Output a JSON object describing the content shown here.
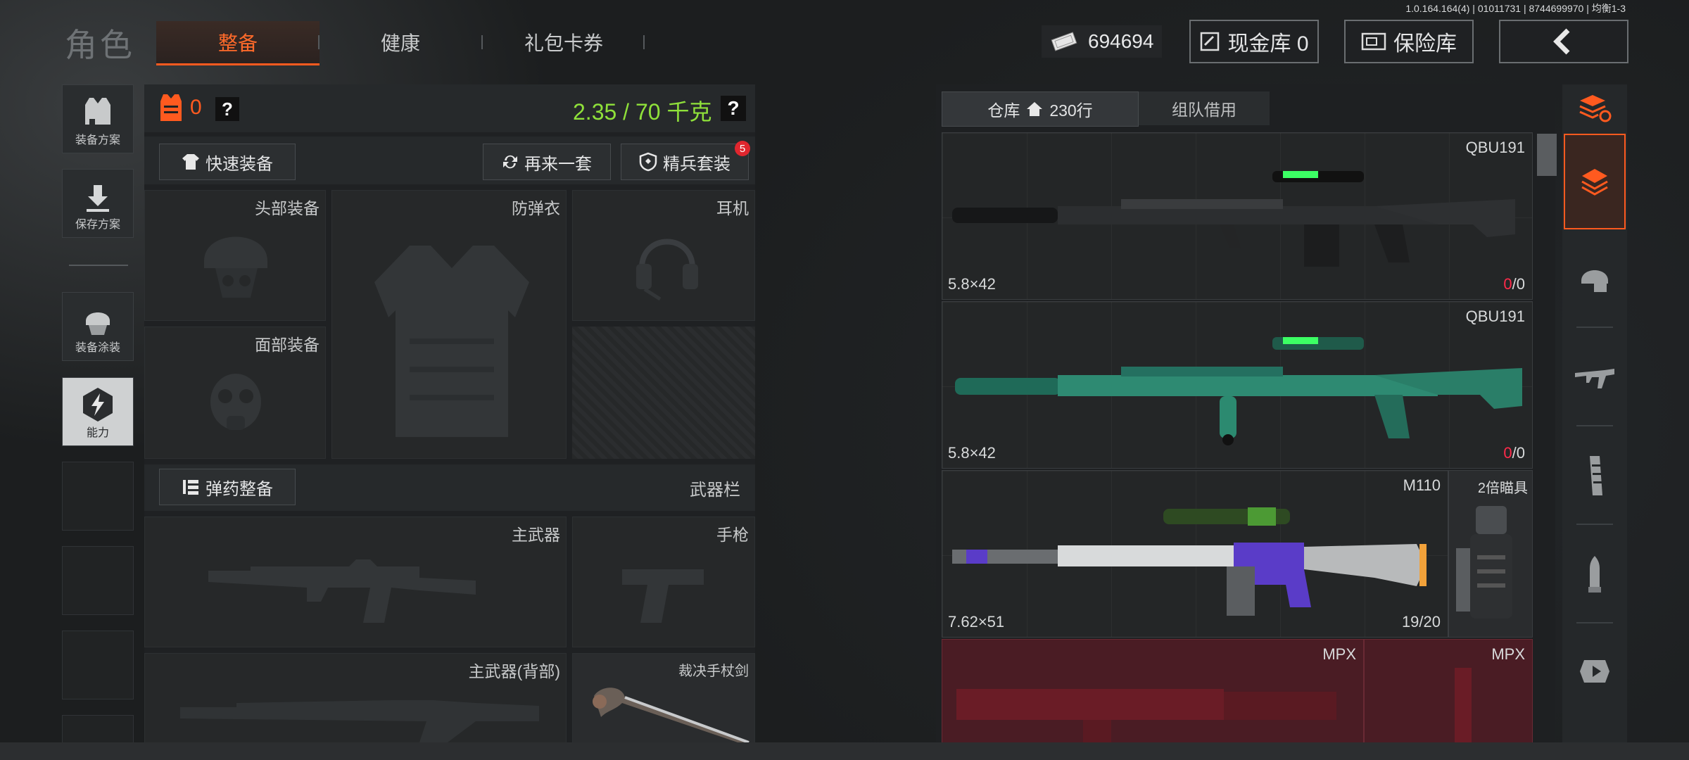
{
  "header": {
    "title": "角色",
    "tabs": [
      {
        "label": "整备"
      },
      {
        "label": "健康"
      },
      {
        "label": "礼包卡券"
      }
    ],
    "version": "1.0.164.164(4) | 01011731 | 8744699970 | 均衡1-3",
    "money": "694694",
    "cash_vault": "现金库 0",
    "insurance": "保险库"
  },
  "left_rail": {
    "items": [
      {
        "label": "装备方案"
      },
      {
        "label": "保存方案"
      },
      {
        "label": "装备涂装"
      },
      {
        "label": "能力"
      }
    ]
  },
  "loadout": {
    "armor_count": "0",
    "weight": "2.35 / 70 千克",
    "help": "?",
    "quick_equip": "快速装备",
    "again": "再来一套",
    "elite": "精兵套装",
    "elite_badge": "5",
    "slots": {
      "head": "头部装备",
      "vest": "防弹衣",
      "ear": "耳机",
      "face": "面部装备",
      "main": "主武器",
      "pistol": "手枪",
      "main_back": "主武器(背部)",
      "melee": "裁决手杖剑"
    },
    "ammo": "弹药整备",
    "weapon_bar": "武器栏"
  },
  "storage": {
    "tab_storage": "仓库",
    "rows": "230行",
    "tab_team": "组队借用",
    "items": [
      {
        "name": "QBU191",
        "caliber": "5.8×42",
        "ammo_a": "0",
        "ammo_b": "/0"
      },
      {
        "name": "QBU191",
        "caliber": "5.8×42",
        "ammo_a": "0",
        "ammo_b": "/0"
      },
      {
        "name": "M110",
        "caliber": "7.62×51",
        "ammo": "19/20",
        "attachment": "2倍瞄具"
      },
      {
        "name": "MPX",
        "second": "MPX"
      }
    ]
  },
  "colors": {
    "accent": "#ff5a1f",
    "weight": "#8fe13a",
    "red": "#ff2a4a"
  }
}
